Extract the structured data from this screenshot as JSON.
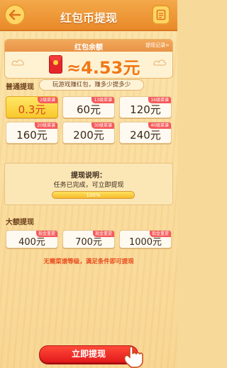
{
  "header": {
    "title": "红包币提现",
    "back_icon": "back-arrow-icon",
    "record_icon": "document-icon"
  },
  "balance": {
    "label": "红包余额",
    "record_link": "提现记录>",
    "amount": "≈4.53元",
    "icon": "red-envelope-icon"
  },
  "normal": {
    "title": "普通提现",
    "tip": "玩游戏赚红包，赚多少提多少",
    "options": [
      {
        "amount": "0.3元",
        "badge": "2级菜谱",
        "selected": true
      },
      {
        "amount": "60元",
        "badge": "13级菜谱",
        "selected": false
      },
      {
        "amount": "120元",
        "badge": "16级菜谱",
        "selected": false
      },
      {
        "amount": "160元",
        "badge": "20级菜谱",
        "selected": false
      },
      {
        "amount": "200元",
        "badge": "30级菜谱",
        "selected": false
      },
      {
        "amount": "240元",
        "badge": "40级菜谱",
        "selected": false
      }
    ]
  },
  "explain": {
    "title": "提现说明：",
    "text": "任务已完成，可立即提现",
    "progress_label": "100%",
    "progress_value": 1.0
  },
  "large": {
    "title": "大额提现",
    "options": [
      {
        "amount": "400元",
        "badge": "现金重提"
      },
      {
        "amount": "700元",
        "badge": "现金重提"
      },
      {
        "amount": "1000元",
        "badge": "现金重提"
      }
    ],
    "note": "无需菜谱等级，满足条件即可提现"
  },
  "action": {
    "button_label": "立即提现",
    "pointer_icon": "pointing-hand-icon"
  },
  "colors": {
    "header": "#e98a2a",
    "accent": "#f07814",
    "badge": "#f55a5a",
    "button": "#e21b1b",
    "selected": "#f8c92c"
  }
}
